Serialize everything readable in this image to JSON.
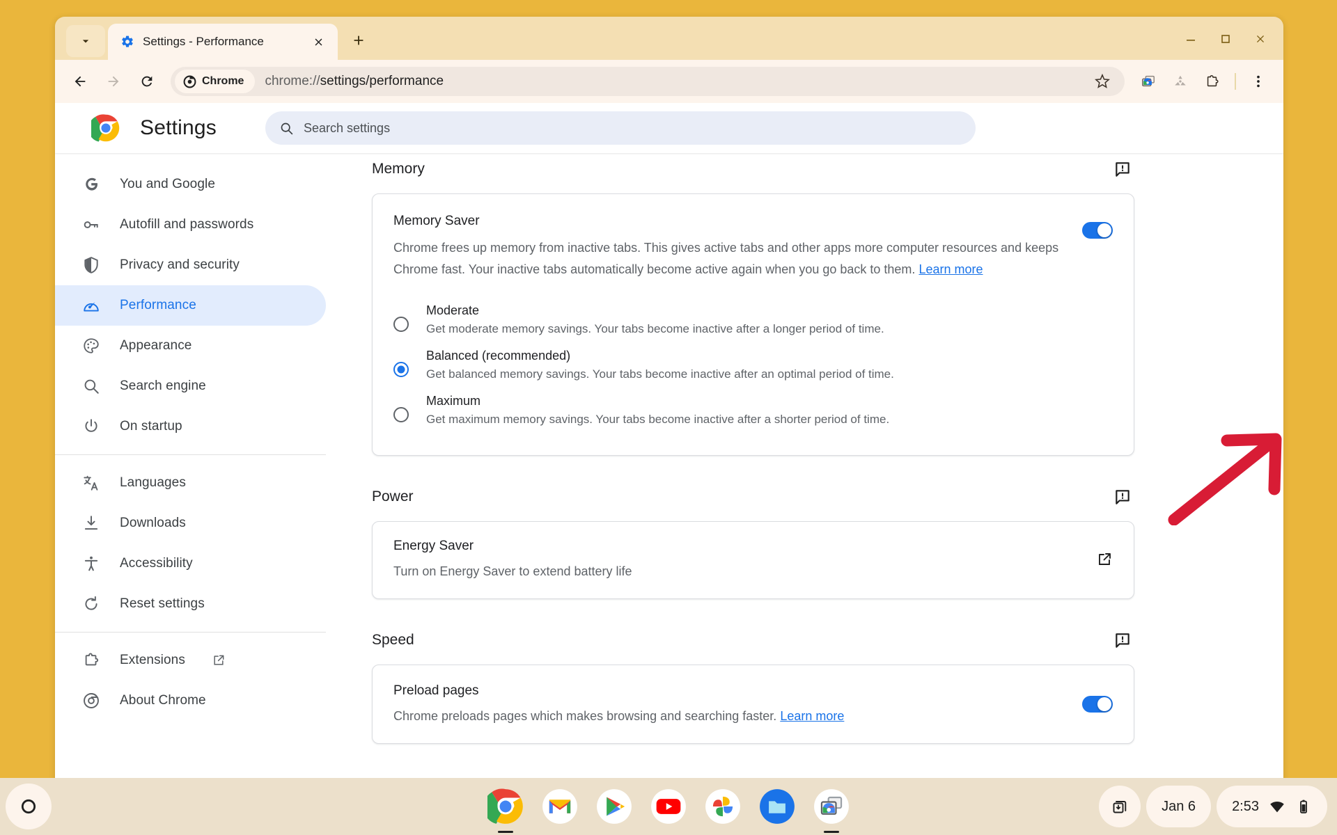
{
  "window": {
    "tab": {
      "title": "Settings - Performance",
      "favicon": "gear-icon",
      "close_label": "×"
    },
    "new_tab_label": "+",
    "controls": {
      "minimize": "—",
      "maximize": "▢",
      "close": "✕"
    }
  },
  "toolbar": {
    "back_label": "Back",
    "forward_label": "Forward",
    "reload_label": "Reload",
    "chrome_chip": "Chrome",
    "url_scheme": "chrome://",
    "url_path": "settings/performance",
    "url_full": "chrome://settings/performance",
    "icons": {
      "bookmark": "star-icon",
      "tab_groups": "tab-group-icon",
      "share": "share-icon",
      "extensions": "extensions-puzzle-icon",
      "menu": "three-dot-menu-icon"
    }
  },
  "settings_header": {
    "title": "Settings",
    "logo": "chrome-logo-icon",
    "search_placeholder": "Search settings",
    "search_value": ""
  },
  "sidebar": {
    "groups": [
      {
        "items": [
          {
            "label": "You and Google",
            "icon": "google-g-icon",
            "selected": false
          },
          {
            "label": "Autofill and passwords",
            "icon": "key-icon",
            "selected": false
          },
          {
            "label": "Privacy and security",
            "icon": "shield-icon",
            "selected": false
          },
          {
            "label": "Performance",
            "icon": "speedometer-icon",
            "selected": true
          },
          {
            "label": "Appearance",
            "icon": "palette-icon",
            "selected": false
          },
          {
            "label": "Search engine",
            "icon": "search-icon",
            "selected": false
          },
          {
            "label": "On startup",
            "icon": "power-icon",
            "selected": false
          }
        ]
      },
      {
        "items": [
          {
            "label": "Languages",
            "icon": "translate-icon",
            "selected": false
          },
          {
            "label": "Downloads",
            "icon": "download-icon",
            "selected": false
          },
          {
            "label": "Accessibility",
            "icon": "accessibility-icon",
            "selected": false
          },
          {
            "label": "Reset settings",
            "icon": "reset-icon",
            "selected": false
          }
        ]
      },
      {
        "items": [
          {
            "label": "Extensions",
            "icon": "extensions-puzzle-icon",
            "external": true,
            "selected": false
          },
          {
            "label": "About Chrome",
            "icon": "chrome-logo-icon",
            "external": false,
            "selected": false
          }
        ]
      }
    ]
  },
  "content": {
    "memory": {
      "section_title": "Memory",
      "feedback_icon": "feedback-icon",
      "card": {
        "title": "Memory Saver",
        "description": "Chrome frees up memory from inactive tabs. This gives active tabs and other apps more computer resources and keeps Chrome fast. Your inactive tabs automatically become active again when you go back to them.",
        "learn_more": "Learn more",
        "toggle_on": true
      },
      "options": [
        {
          "label": "Moderate",
          "description": "Get moderate memory savings. Your tabs become inactive after a longer period of time.",
          "selected": false
        },
        {
          "label": "Balanced (recommended)",
          "description": "Get balanced memory savings. Your tabs become inactive after an optimal period of time.",
          "selected": true
        },
        {
          "label": "Maximum",
          "description": "Get maximum memory savings. Your tabs become inactive after a shorter period of time.",
          "selected": false
        }
      ]
    },
    "power": {
      "section_title": "Power",
      "feedback_icon": "feedback-icon",
      "card": {
        "title": "Energy Saver",
        "description": "Turn on Energy Saver to extend battery life",
        "action_icon": "open-in-new-icon"
      }
    },
    "speed": {
      "section_title": "Speed",
      "feedback_icon": "feedback-icon",
      "card": {
        "title": "Preload pages",
        "description": "Chrome preloads pages which makes browsing and searching faster.",
        "learn_more": "Learn more",
        "toggle_on": true
      }
    }
  },
  "annotation": {
    "arrow_color": "#d81c35",
    "points_to": "memory-saver-toggle"
  },
  "shelf": {
    "launcher_icon": "launcher-circle-icon",
    "apps": [
      {
        "name": "Chrome",
        "icon": "chrome-icon",
        "running": true
      },
      {
        "name": "Gmail",
        "icon": "gmail-icon",
        "running": false
      },
      {
        "name": "Play Store",
        "icon": "play-store-icon",
        "running": false
      },
      {
        "name": "YouTube",
        "icon": "youtube-icon",
        "running": false
      },
      {
        "name": "Photos",
        "icon": "photos-icon",
        "running": false
      },
      {
        "name": "Files",
        "icon": "files-icon",
        "running": false
      },
      {
        "name": "Tab Groups",
        "icon": "tab-group-icon",
        "running": true
      }
    ],
    "status": {
      "download_icon": "download-tray-icon",
      "date": "Jan 6",
      "time": "2:53",
      "wifi_icon": "wifi-icon",
      "battery_icon": "battery-icon"
    }
  },
  "colors": {
    "desktop": "#eab63c",
    "window_frame": "#f4dfb3",
    "toolbar": "#fdf4ec",
    "accent_blue": "#1a73e8",
    "shelf": "#ece0cb",
    "arrow_red": "#d81c35"
  }
}
